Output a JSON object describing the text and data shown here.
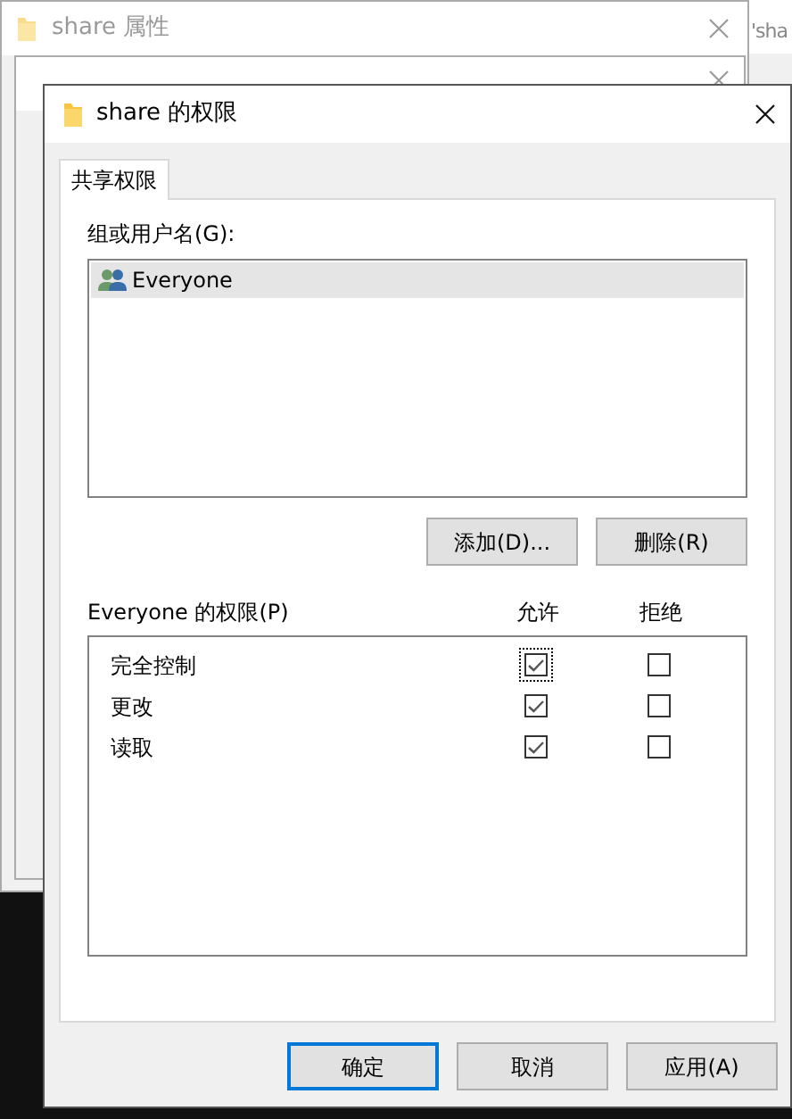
{
  "background_windows": [
    {
      "title": "share 属性"
    }
  ],
  "edge_window_text": "'sha",
  "dialog": {
    "title": "share 的权限",
    "tabs": [
      {
        "label": "共享权限",
        "selected": true
      }
    ],
    "group_label": "组或用户名(G):",
    "users": [
      {
        "name": "Everyone",
        "selected": true
      }
    ],
    "user_buttons": [
      "添加(D)...",
      "删除(R)"
    ],
    "permissions_label": "Everyone 的权限(P)",
    "columns": [
      "允许",
      "拒绝"
    ],
    "permissions": [
      {
        "name": "完全控制",
        "allow": true,
        "deny": false,
        "focused": true
      },
      {
        "name": "更改",
        "allow": true,
        "deny": false,
        "focused": false
      },
      {
        "name": "读取",
        "allow": true,
        "deny": false,
        "focused": false
      }
    ],
    "footer_buttons": [
      {
        "label": "确定",
        "default": true
      },
      {
        "label": "取消",
        "default": false
      },
      {
        "label": "应用(A)",
        "default": false
      }
    ]
  }
}
